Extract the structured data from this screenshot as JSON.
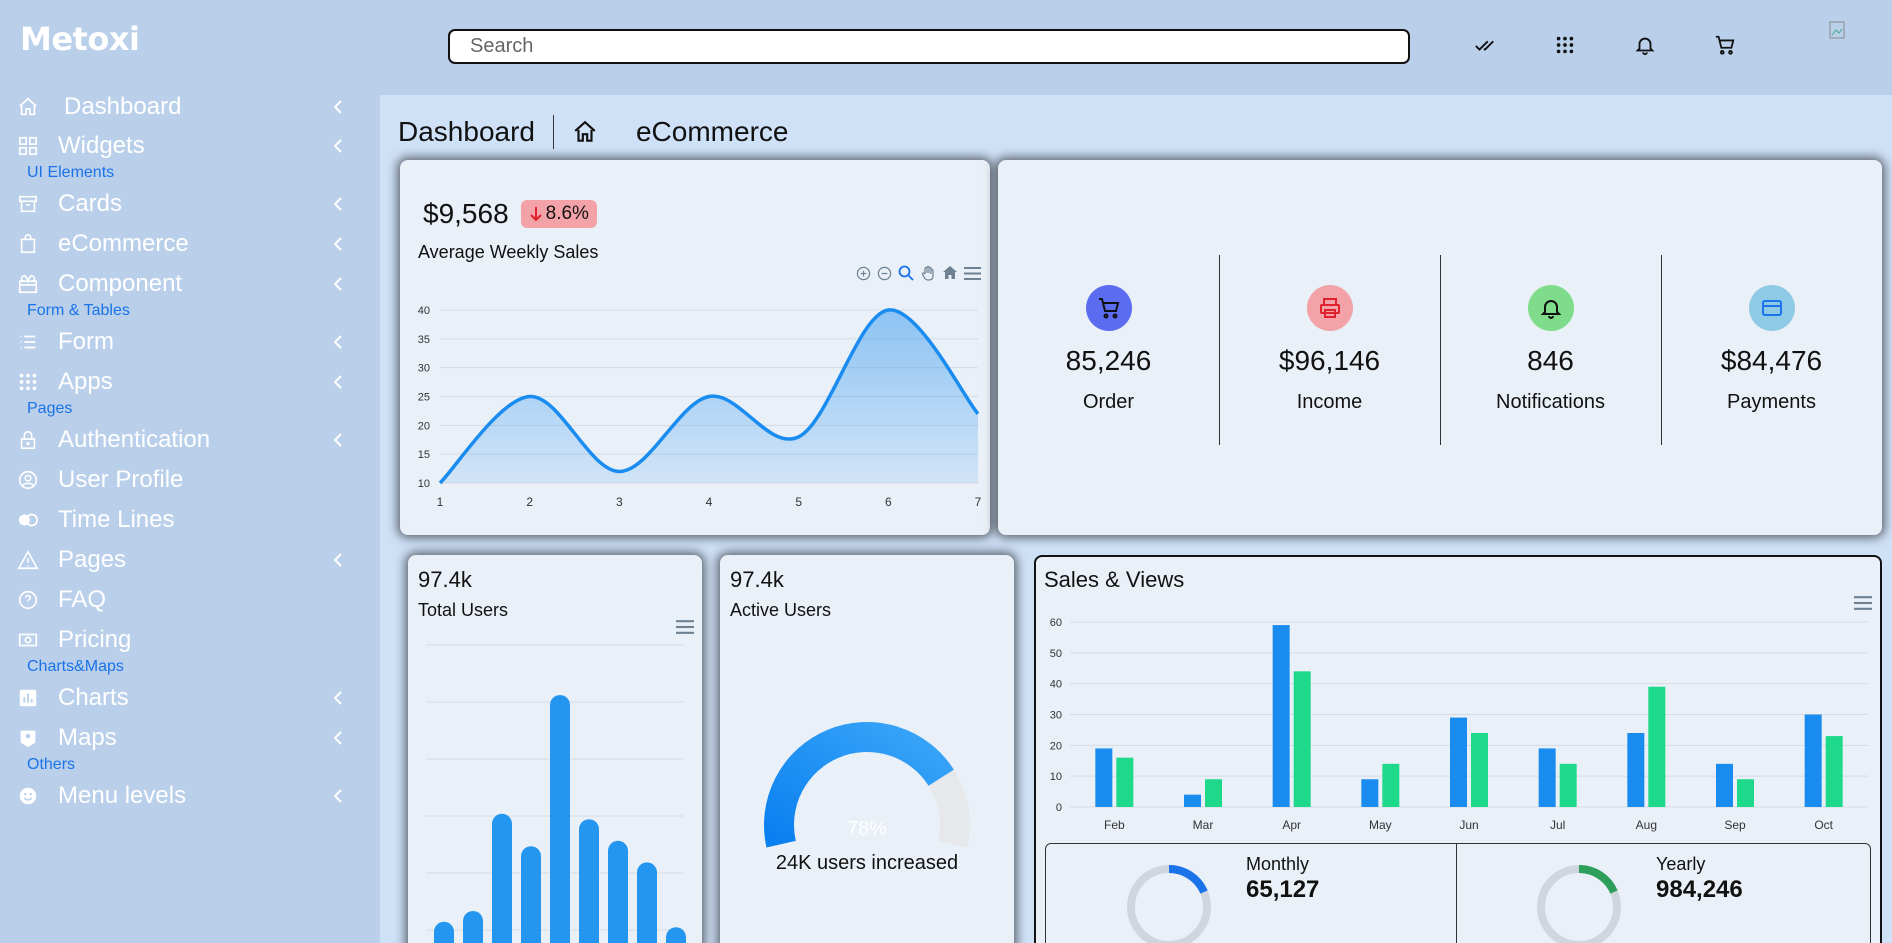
{
  "brand": "Metoxi",
  "sidebar": {
    "items": [
      {
        "label": "Dashboard",
        "icon": "home-icon"
      },
      {
        "label": "Widgets",
        "icon": "widgets-icon"
      },
      {
        "label": "Cards",
        "icon": "archive-icon"
      },
      {
        "label": "eCommerce",
        "icon": "shopping-bag-icon"
      },
      {
        "label": "Component",
        "icon": "gift-icon"
      },
      {
        "label": "Form",
        "icon": "list-icon"
      },
      {
        "label": "Apps",
        "icon": "apps-grid-icon"
      },
      {
        "label": "Authentication",
        "icon": "lock-icon"
      },
      {
        "label": "User Profile",
        "icon": "user-circle-icon"
      },
      {
        "label": "Time Lines",
        "icon": "timeline-icon"
      },
      {
        "label": "Pages",
        "icon": "warning-icon"
      },
      {
        "label": "FAQ",
        "icon": "help-circle-icon"
      },
      {
        "label": "Pricing",
        "icon": "money-icon"
      },
      {
        "label": "Charts",
        "icon": "bar-chart-icon"
      },
      {
        "label": "Maps",
        "icon": "map-icon"
      },
      {
        "label": "Menu levels",
        "icon": "smile-icon"
      }
    ],
    "sections": [
      "UI Elements",
      "Form & Tables",
      "Pages",
      "Charts&Maps",
      "Others"
    ]
  },
  "header": {
    "search_placeholder": "Search",
    "icons": [
      "double-check-icon",
      "apps-grid-icon",
      "bell-icon",
      "cart-icon"
    ]
  },
  "breadcrumb": {
    "title": "Dashboard",
    "current": "eCommerce"
  },
  "weekly_sales": {
    "value": "$9,568",
    "change": "8.6%",
    "label": "Average Weekly Sales",
    "toolbar": [
      "zoom-in-icon",
      "zoom-out-icon",
      "magnify-icon",
      "pan-hand-icon",
      "reset-home-icon",
      "menu-icon"
    ]
  },
  "stats": [
    {
      "value": "85,246",
      "label": "Order",
      "icon": "cart-icon",
      "color": "#5b6cf0"
    },
    {
      "value": "$96,146",
      "label": "Income",
      "icon": "printer-icon",
      "color": "#f3a3a8"
    },
    {
      "value": "846",
      "label": "Notifications",
      "icon": "bell-icon",
      "color": "#7fdc8a"
    },
    {
      "value": "$84,476",
      "label": "Payments",
      "icon": "credit-card-icon",
      "color": "#8ec9e6"
    }
  ],
  "total_users": {
    "value": "97.4k",
    "label": "Total Users"
  },
  "active_users": {
    "value": "97.4k",
    "label": "Active Users",
    "gauge": "78%",
    "footer": "24K users increased"
  },
  "sales_views": {
    "title": "Sales & Views",
    "monthly": {
      "label": "Monthly",
      "value": "65,127"
    },
    "yearly": {
      "label": "Yearly",
      "value": "984,246"
    }
  },
  "colors": {
    "accent": "#1a8cf0",
    "views": "#1ed98a",
    "sales": "#1a8cf0"
  },
  "chart_data": [
    {
      "type": "area",
      "x": [
        1,
        2,
        3,
        4,
        5,
        6,
        7
      ],
      "series": [
        {
          "values": [
            10,
            25,
            12,
            25,
            18,
            40,
            22
          ]
        }
      ],
      "ylim": [
        10,
        40
      ],
      "yticks": [
        10,
        15,
        20,
        25,
        30,
        35,
        40
      ],
      "xticks": [
        1,
        2,
        3,
        4,
        5,
        6,
        7
      ]
    },
    {
      "type": "bar",
      "values": [
        8,
        10,
        28,
        22,
        50,
        27,
        23,
        19,
        7
      ]
    },
    {
      "type": "bar",
      "categories": [
        "Feb",
        "Mar",
        "Apr",
        "May",
        "Jun",
        "Jul",
        "Aug",
        "Sep",
        "Oct"
      ],
      "series": [
        {
          "name": "sales",
          "values": [
            19,
            4,
            59,
            9,
            29,
            19,
            24,
            14,
            30
          ]
        },
        {
          "name": "views",
          "values": [
            16,
            9,
            44,
            14,
            24,
            14,
            39,
            9,
            23
          ]
        }
      ],
      "ylim": [
        0,
        60
      ],
      "yticks": [
        0,
        10,
        20,
        30,
        40,
        50,
        60
      ],
      "legend": "bottom-center"
    }
  ]
}
